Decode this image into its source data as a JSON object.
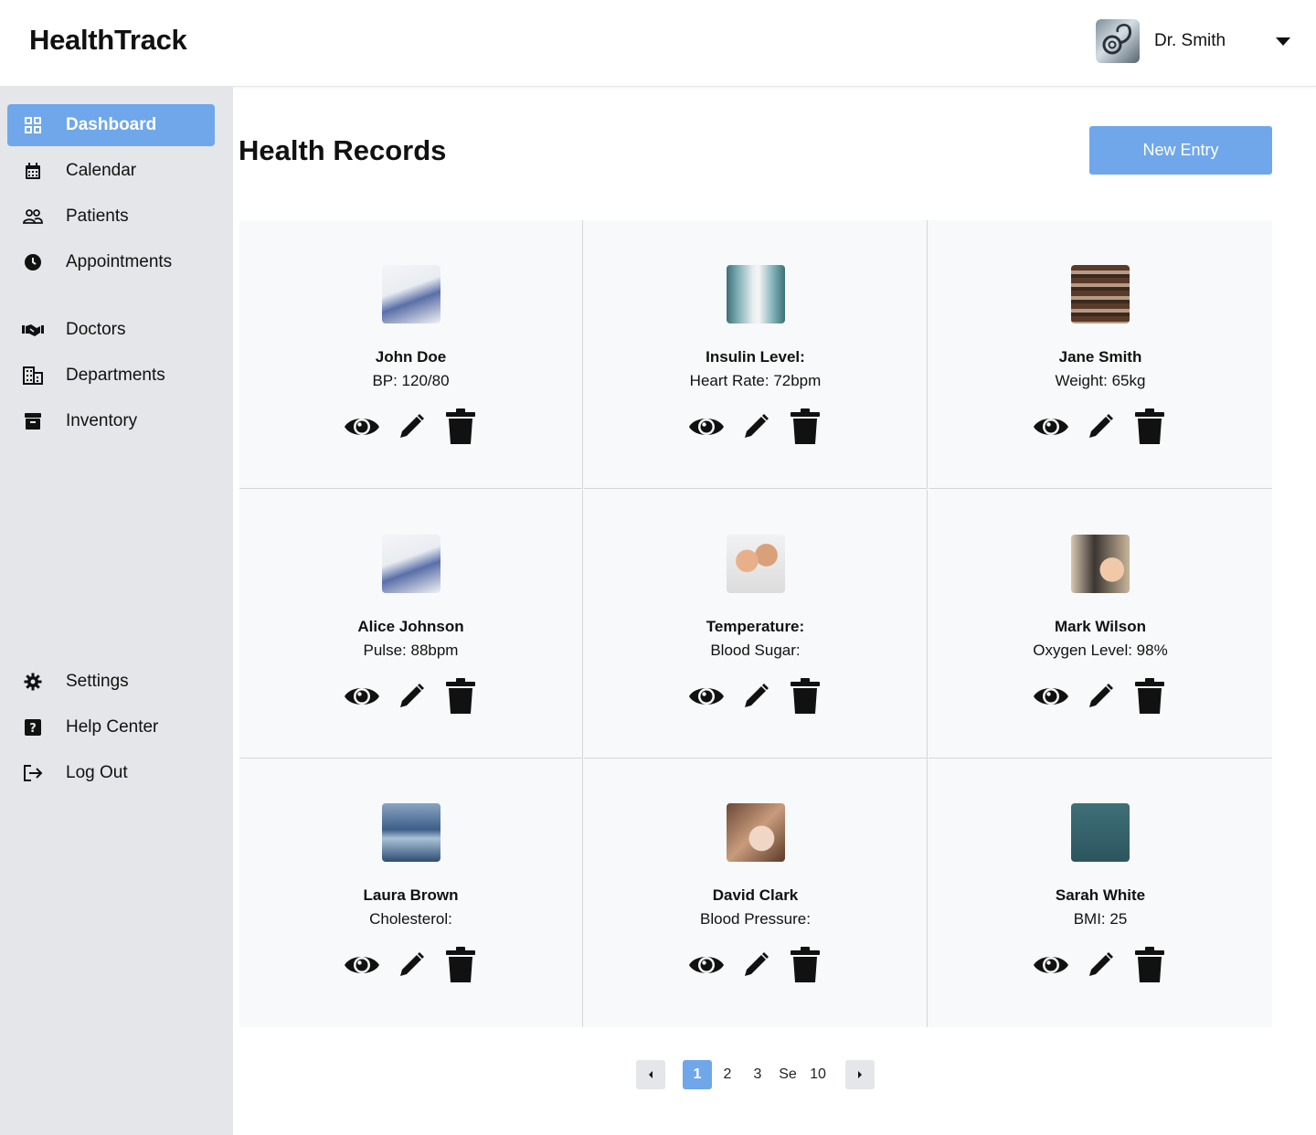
{
  "app": {
    "brand": "HealthTrack"
  },
  "user": {
    "name": "Dr. Smith",
    "avatar_icon": "stethoscope-avatar"
  },
  "colors": {
    "accent": "#6fa7ea",
    "sidebar_bg": "#e5e6ea",
    "card_bg": "#f8f9fa"
  },
  "sidebar": {
    "items": [
      {
        "label": "Dashboard",
        "icon": "dashboard-grid-icon",
        "active": true
      },
      {
        "label": "Calendar",
        "icon": "calendar-icon"
      },
      {
        "label": "Patients",
        "icon": "people-icon"
      },
      {
        "label": "Appointments",
        "icon": "clock-icon"
      },
      {
        "label": "Doctors",
        "icon": "handshake-icon"
      },
      {
        "label": "Departments",
        "icon": "building-icon"
      },
      {
        "label": "Inventory",
        "icon": "archive-box-icon"
      }
    ],
    "footer_items": [
      {
        "label": "Settings",
        "icon": "gear-icon"
      },
      {
        "label": "Help Center",
        "icon": "help-icon"
      },
      {
        "label": "Log Out",
        "icon": "logout-icon"
      }
    ]
  },
  "main": {
    "title": "Health Records",
    "new_entry_label": "New Entry",
    "records": [
      {
        "name": "John Doe",
        "metric": "BP: 120/80"
      },
      {
        "name": "Insulin Level:",
        "metric": "Heart Rate: 72bpm"
      },
      {
        "name": "Jane Smith",
        "metric": "Weight: 65kg"
      },
      {
        "name": "Alice Johnson",
        "metric": "Pulse: 88bpm"
      },
      {
        "name": "Temperature:",
        "metric": "Blood Sugar:"
      },
      {
        "name": "Mark Wilson",
        "metric": "Oxygen Level: 98%"
      },
      {
        "name": "Laura Brown",
        "metric": "Cholesterol:"
      },
      {
        "name": "David Clark",
        "metric": "Blood Pressure:"
      },
      {
        "name": "Sarah White",
        "metric": "BMI: 25"
      }
    ]
  },
  "pagination": {
    "pages": [
      "1",
      "2",
      "3",
      "Se",
      "10"
    ],
    "current": "1"
  }
}
